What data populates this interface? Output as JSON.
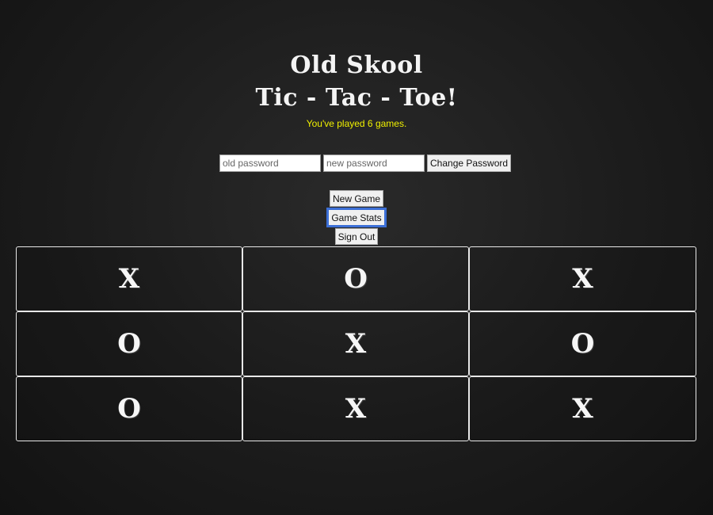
{
  "header": {
    "title_line1": "Old Skool",
    "title_line2": "Tic - Tac - Toe!",
    "games_played": "You've played 6 games."
  },
  "password_form": {
    "old_placeholder": "old password",
    "new_placeholder": "new password",
    "change_label": "Change Password"
  },
  "menu": {
    "new_game": "New Game",
    "game_stats": "Game Stats",
    "sign_out": "Sign Out"
  },
  "board": {
    "cells": [
      "X",
      "O",
      "X",
      "O",
      "X",
      "O",
      "O",
      "X",
      "X"
    ]
  },
  "colors": {
    "games_played_text": "#f0f000",
    "focus_ring": "#3c6fd6"
  }
}
